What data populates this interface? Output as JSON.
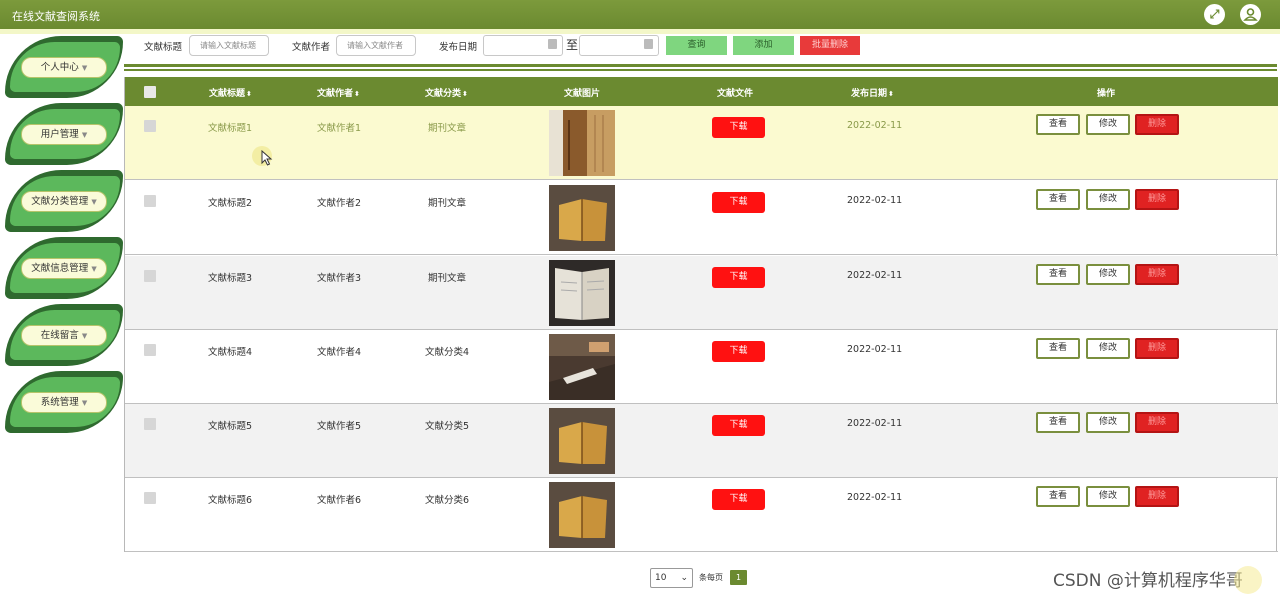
{
  "app": {
    "title": "在线文献查阅系统"
  },
  "topbar": {
    "fullscreen_icon": "expand-icon",
    "user_icon": "user-icon"
  },
  "sidebar": {
    "items": [
      {
        "label": "个人中心"
      },
      {
        "label": "用户管理"
      },
      {
        "label": "文献分类管理"
      },
      {
        "label": "文献信息管理"
      },
      {
        "label": "在线留言"
      },
      {
        "label": "系统管理"
      }
    ]
  },
  "search": {
    "title_label": "文献标题",
    "title_placeholder": "请输入文献标题",
    "author_label": "文献作者",
    "author_placeholder": "请输入文献作者",
    "date_label": "发布日期",
    "date_to": "至",
    "query_label": "查询",
    "add_label": "添加",
    "batch_delete_label": "批量删除"
  },
  "table": {
    "columns": [
      "文献标题",
      "文献作者",
      "文献分类",
      "文献图片",
      "文献文件",
      "发布日期",
      "操作"
    ],
    "sort_glyph": "⬍",
    "rows": [
      {
        "title": "文献标题1",
        "author": "文献作者1",
        "category": "期刊文章",
        "download": "下载",
        "date": "2022-02-11"
      },
      {
        "title": "文献标题2",
        "author": "文献作者2",
        "category": "期刊文章",
        "download": "下载",
        "date": "2022-02-11"
      },
      {
        "title": "文献标题3",
        "author": "文献作者3",
        "category": "期刊文章",
        "download": "下载",
        "date": "2022-02-11"
      },
      {
        "title": "文献标题4",
        "author": "文献作者4",
        "category": "文献分类4",
        "download": "下载",
        "date": "2022-02-11"
      },
      {
        "title": "文献标题5",
        "author": "文献作者5",
        "category": "文献分类5",
        "download": "下载",
        "date": "2022-02-11"
      },
      {
        "title": "文献标题6",
        "author": "文献作者6",
        "category": "文献分类6",
        "download": "下载",
        "date": "2022-02-11"
      }
    ],
    "actions": {
      "view": "查看",
      "edit": "修改",
      "delete": "删除"
    }
  },
  "pagination": {
    "page_size": "10",
    "per_page_label": "条每页",
    "current_page": "1"
  },
  "watermark": "CSDN @计算机程序华哥",
  "colors": {
    "header": "#6b8a30",
    "accent_green": "#5cb85c",
    "danger": "#ff1111"
  }
}
